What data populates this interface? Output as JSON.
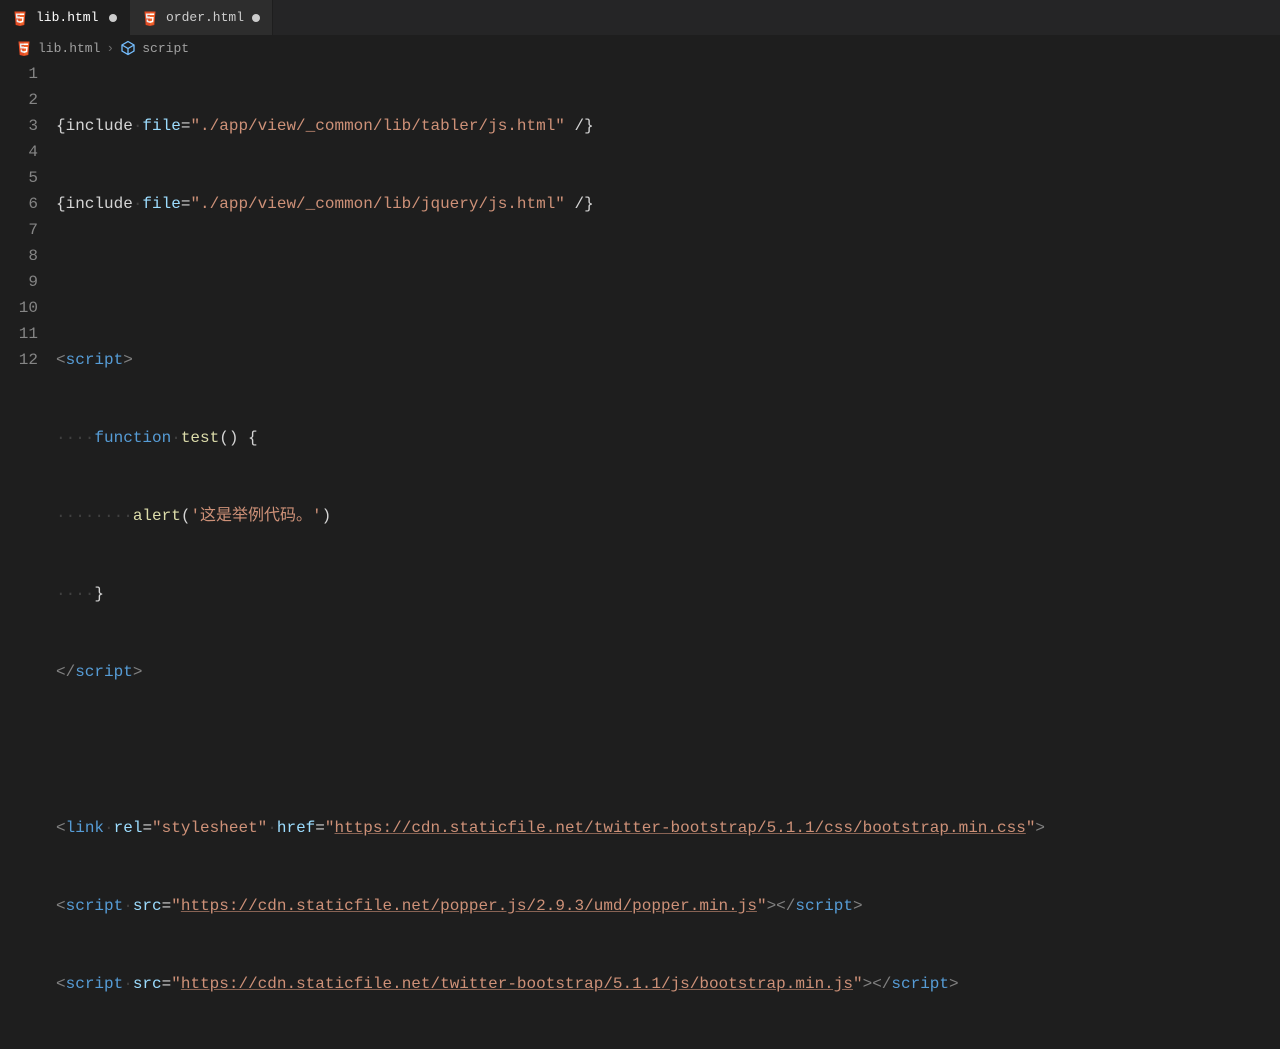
{
  "tabs": [
    {
      "label": "lib.html",
      "icon": "html5",
      "dirty": true,
      "active": true
    },
    {
      "label": "order.html",
      "icon": "html5",
      "dirty": true,
      "active": false
    }
  ],
  "breadcrumb": {
    "file_icon": "html5",
    "file": "lib.html",
    "sep": "›",
    "symbol_icon": "block",
    "symbol": "script"
  },
  "lineNumbers": [
    "1",
    "2",
    "3",
    "4",
    "5",
    "6",
    "7",
    "8",
    "9",
    "10",
    "11",
    "12"
  ],
  "code": {
    "l1": {
      "include": "{include",
      "dot": "·",
      "file_attr": "file",
      "eq": "=",
      "path": "\"./app/view/_common/lib/tabler/js.html\"",
      "sp": " ",
      "close": "/}"
    },
    "l2": {
      "include": "{include",
      "dot": "·",
      "file_attr": "file",
      "eq": "=",
      "path": "\"./app/view/_common/lib/jquery/js.html\"",
      "sp": " ",
      "close": "/}"
    },
    "l4": {
      "lt": "<",
      "tag": "script",
      "gt": ">"
    },
    "l5": {
      "indent": "····",
      "fn": "function",
      "sp": "·",
      "name": "test",
      "parens": "()",
      "sp2": " ",
      "brace": "{"
    },
    "l6": {
      "indent": "········",
      "alert": "alert",
      "paren_l": "(",
      "str": "'这是举例代码。'",
      "paren_r": ")"
    },
    "l7": {
      "indent": "····",
      "brace": "}"
    },
    "l8": {
      "lt": "</",
      "tag": "script",
      "gt": ">"
    },
    "l10": {
      "lt": "<",
      "tag": "link",
      "sp": "·",
      "rel": "rel",
      "eq": "=",
      "relv": "\"stylesheet\"",
      "sp2": "·",
      "href": "href",
      "eq2": "=",
      "q": "\"",
      "url": "https://cdn.staticfile.net/twitter-bootstrap/5.1.1/css/bootstrap.min.css",
      "q2": "\"",
      "gt": ">"
    },
    "l11": {
      "lt": "<",
      "tag": "script",
      "sp": "·",
      "src": "src",
      "eq": "=",
      "q": "\"",
      "url": "https://cdn.staticfile.net/popper.js/2.9.3/umd/popper.min.js",
      "q2": "\"",
      "gt": ">",
      "lt2": "</",
      "tag2": "script",
      "gt2": ">"
    },
    "l12": {
      "lt": "<",
      "tag": "script",
      "sp": "·",
      "src": "src",
      "eq": "=",
      "q": "\"",
      "url": "https://cdn.staticfile.net/twitter-bootstrap/5.1.1/js/bootstrap.min.js",
      "q2": "\"",
      "gt": ">",
      "lt2": "</",
      "tag2": "script",
      "gt2": ">"
    }
  }
}
